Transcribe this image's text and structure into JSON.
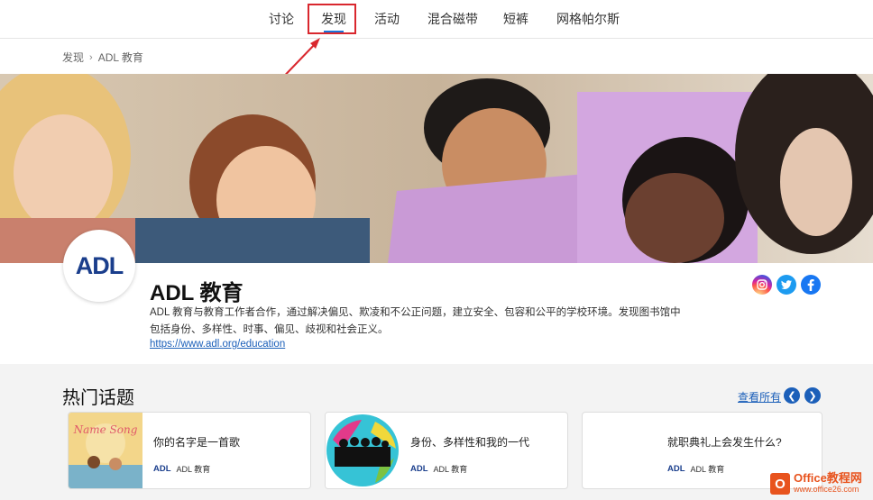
{
  "nav": {
    "tabs": [
      {
        "label": "讨论"
      },
      {
        "label": "发现"
      },
      {
        "label": "活动"
      },
      {
        "label": "混合磁带"
      },
      {
        "label": "短裤"
      },
      {
        "label": "网格帕尔斯"
      }
    ],
    "active_tab": "发现"
  },
  "breadcrumb": {
    "root": "发现",
    "current": "ADL 教育"
  },
  "profile": {
    "logo_text": "ADL",
    "title": "ADL 教育",
    "description": "ADL 教育与教育工作者合作，通过解决偏见、欺凌和不公正问题，建立安全、包容和公平的学校环境。发现图书馆中包括身份、多样性、时事、偏见、歧视和社会正义。",
    "link": "https://www.adl.org/education"
  },
  "social": {
    "instagram_icon": "instagram-icon",
    "twitter_icon": "twitter-icon",
    "facebook_icon": "facebook-icon"
  },
  "trending": {
    "title": "热门话题",
    "see_all": "查看所有",
    "cards": [
      {
        "title": "你的名字是一首歌",
        "source_logo": "ADL",
        "source": "ADL 教育",
        "thumb_text": "Name Song"
      },
      {
        "title": "身份、多样性和我的一代",
        "source_logo": "ADL",
        "source": "ADL 教育"
      },
      {
        "title": "就职典礼上会发生什么?",
        "source_logo": "ADL",
        "source": "ADL 教育"
      }
    ]
  },
  "watermark": {
    "brand": "Office教程网",
    "url": "www.office26.com"
  },
  "colors": {
    "accent": "#1b5fb9",
    "highlight": "#d9272e",
    "trending_bg": "#f3f3f3"
  }
}
